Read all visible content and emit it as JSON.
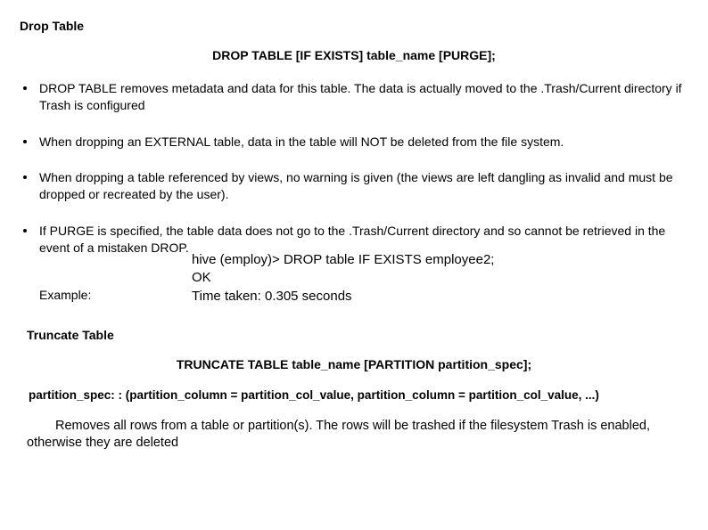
{
  "drop": {
    "title": "Drop Table",
    "syntax": "DROP TABLE [IF EXISTS] table_name [PURGE];",
    "bullets": [
      "DROP TABLE removes metadata and data for this table. The data is actually moved to the .Trash/Current directory if Trash is configured",
      "When dropping an EXTERNAL table, data in the table will NOT be deleted from the file system.",
      "When dropping a table referenced by views, no warning is given (the views are left dangling as invalid and must be dropped or recreated by the user)."
    ],
    "purge_text": "If PURGE is specified, the table data does not go to the .Trash/Current directory and so cannot be retrieved in the event of a mistaken DROP.",
    "example_label": "Example:",
    "code": {
      "line1": "hive (employ)> DROP table IF EXISTS employee2;",
      "line2": "OK",
      "line3": "Time taken: 0.305 seconds"
    }
  },
  "truncate": {
    "title": "Truncate Table",
    "syntax": "TRUNCATE TABLE table_name [PARTITION partition_spec];",
    "partition_spec": "partition_spec:  : (partition_column = partition_col_value, partition_column = partition_col_value, ...)",
    "desc": "Removes all rows from a table or partition(s). The rows will be trashed if the filesystem Trash is enabled, otherwise they are deleted"
  }
}
